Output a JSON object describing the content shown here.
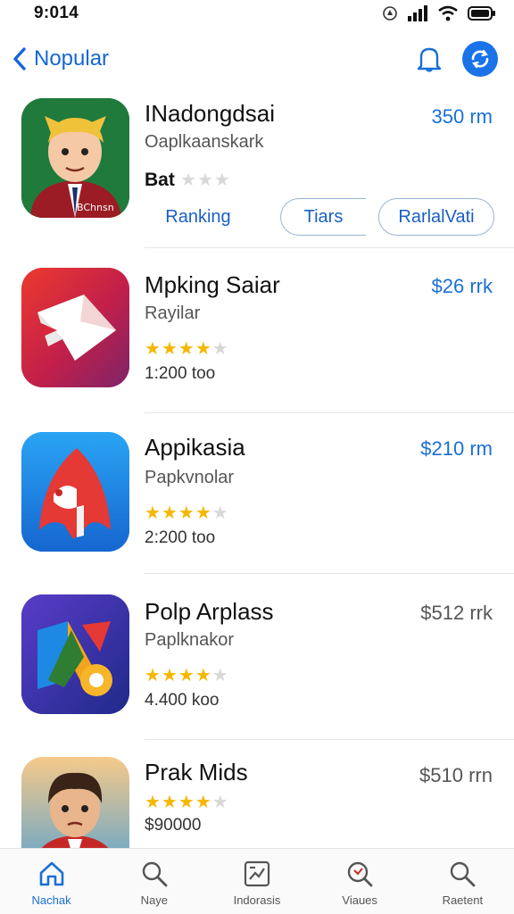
{
  "status": {
    "time": "9:014"
  },
  "nav": {
    "back_label": "Nopular"
  },
  "apps": [
    {
      "title": "INadongdsai",
      "price": "350 rm",
      "subtitle": "Oaplkaanskark",
      "rating_label": "Bat",
      "chips": [
        "Ranking",
        "Tiars",
        "RarlalVati"
      ],
      "icon": "cartoon-cat-boy-icon"
    },
    {
      "title": "Mpking Saiar",
      "price": "$26 rrk",
      "subtitle": "Rayilar",
      "stars": 4,
      "count": "1:200 too",
      "icon": "paper-plane-icon"
    },
    {
      "title": "Appikasia",
      "price": "$210 rm",
      "subtitle": "Papkvnolar",
      "stars": 4,
      "count": "2:200 too",
      "icon": "red-bird-icon"
    },
    {
      "title": "Polp Arplass",
      "price": "$512 rrk",
      "subtitle": "Paplknakor",
      "stars": 4,
      "count": "4.400 koo",
      "icon": "geometric-shapes-icon"
    },
    {
      "title": "Prak Mids",
      "price": "$510 rrn",
      "stars": 4,
      "count": "$90000",
      "icon": "cartoon-man-icon"
    }
  ],
  "tabs": [
    {
      "label": "Nachak",
      "icon": "home-icon",
      "active": true
    },
    {
      "label": "Naye",
      "icon": "search-icon"
    },
    {
      "label": "Indorasis",
      "icon": "chart-icon"
    },
    {
      "label": "Viaues",
      "icon": "search-alt-icon"
    },
    {
      "label": "Raetent",
      "icon": "search-icon"
    }
  ],
  "colors": {
    "accent": "#1a73e8",
    "star": "#f5b700"
  }
}
